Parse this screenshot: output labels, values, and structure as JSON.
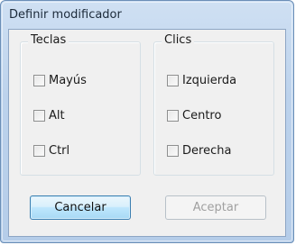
{
  "window": {
    "title": "Definir modificador"
  },
  "keys_group": {
    "title": "Teclas",
    "items": [
      {
        "label": "Mayús",
        "checked": false
      },
      {
        "label": "Alt",
        "checked": false
      },
      {
        "label": "Ctrl",
        "checked": false
      }
    ]
  },
  "clicks_group": {
    "title": "Clics",
    "items": [
      {
        "label": "Izquierda",
        "checked": false
      },
      {
        "label": "Centro",
        "checked": false
      },
      {
        "label": "Derecha",
        "checked": false
      }
    ]
  },
  "buttons": {
    "cancel_label": "Cancelar",
    "accept_label": "Aceptar",
    "accept_enabled": false
  },
  "colors": {
    "title_bar": "#bcd2ec",
    "client_background": "#f0f0f0",
    "default_button_border": "#3c7fb1",
    "disabled_text": "#a0a0a0"
  }
}
